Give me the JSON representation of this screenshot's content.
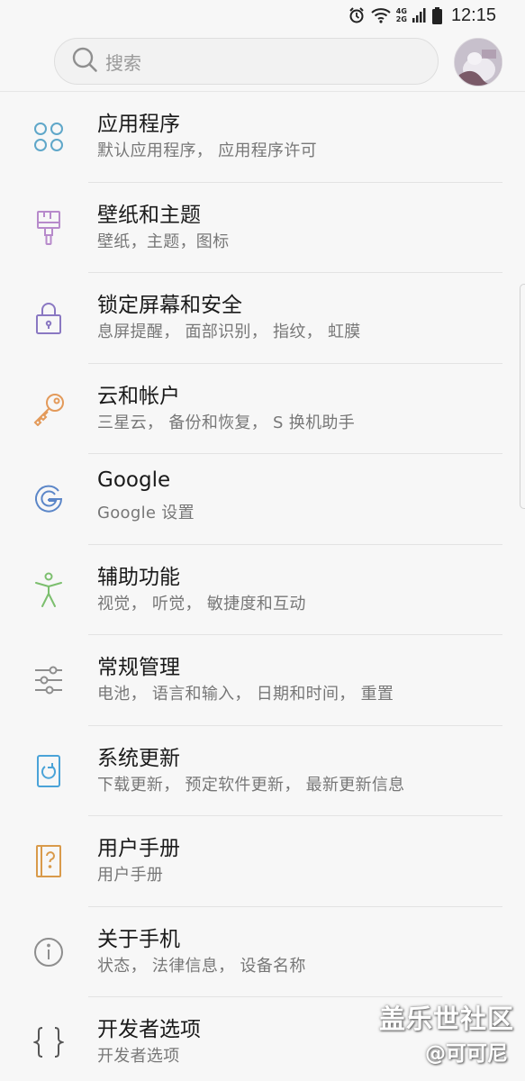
{
  "status_bar": {
    "network_top": "4G",
    "network_bottom": "2G",
    "time": "12:15"
  },
  "search": {
    "placeholder": "搜索"
  },
  "settings": [
    {
      "title": "应用程序",
      "subtitle": "默认应用程序， 应用程序许可",
      "icon": "apps-grid-icon",
      "color": "#5fa7c9"
    },
    {
      "title": "壁纸和主题",
      "subtitle": "壁纸，主题，图标",
      "icon": "paint-brush-icon",
      "color": "#b78acb"
    },
    {
      "title": "锁定屏幕和安全",
      "subtitle": "息屏提醒， 面部识别， 指纹， 虹膜",
      "icon": "padlock-icon",
      "color": "#8a78c2"
    },
    {
      "title": "云和帐户",
      "subtitle": "三星云， 备份和恢复， S 换机助手",
      "icon": "key-icon",
      "color": "#e39a5a"
    },
    {
      "title": "Google",
      "subtitle": "Google 设置",
      "icon": "google-icon",
      "color": "#5b86c8"
    },
    {
      "title": "辅助功能",
      "subtitle": "视觉， 听觉， 敏捷度和互动",
      "icon": "accessibility-icon",
      "color": "#7cbf6e"
    },
    {
      "title": "常规管理",
      "subtitle": "电池， 语言和输入， 日期和时间， 重置",
      "icon": "sliders-icon",
      "color": "#8e8e8e"
    },
    {
      "title": "系统更新",
      "subtitle": "下载更新， 预定软件更新， 最新更新信息",
      "icon": "system-update-icon",
      "color": "#4aa3d8"
    },
    {
      "title": "用户手册",
      "subtitle": "用户手册",
      "icon": "user-manual-icon",
      "color": "#d99a4a"
    },
    {
      "title": "关于手机",
      "subtitle": "状态， 法律信息， 设备名称",
      "icon": "info-icon",
      "color": "#8e8e8e"
    },
    {
      "title": "开发者选项",
      "subtitle": "开发者选项",
      "icon": "developer-braces-icon",
      "color": "#555555"
    }
  ],
  "watermark": {
    "line1": "盖乐世社区",
    "line2": "@可可尼"
  }
}
